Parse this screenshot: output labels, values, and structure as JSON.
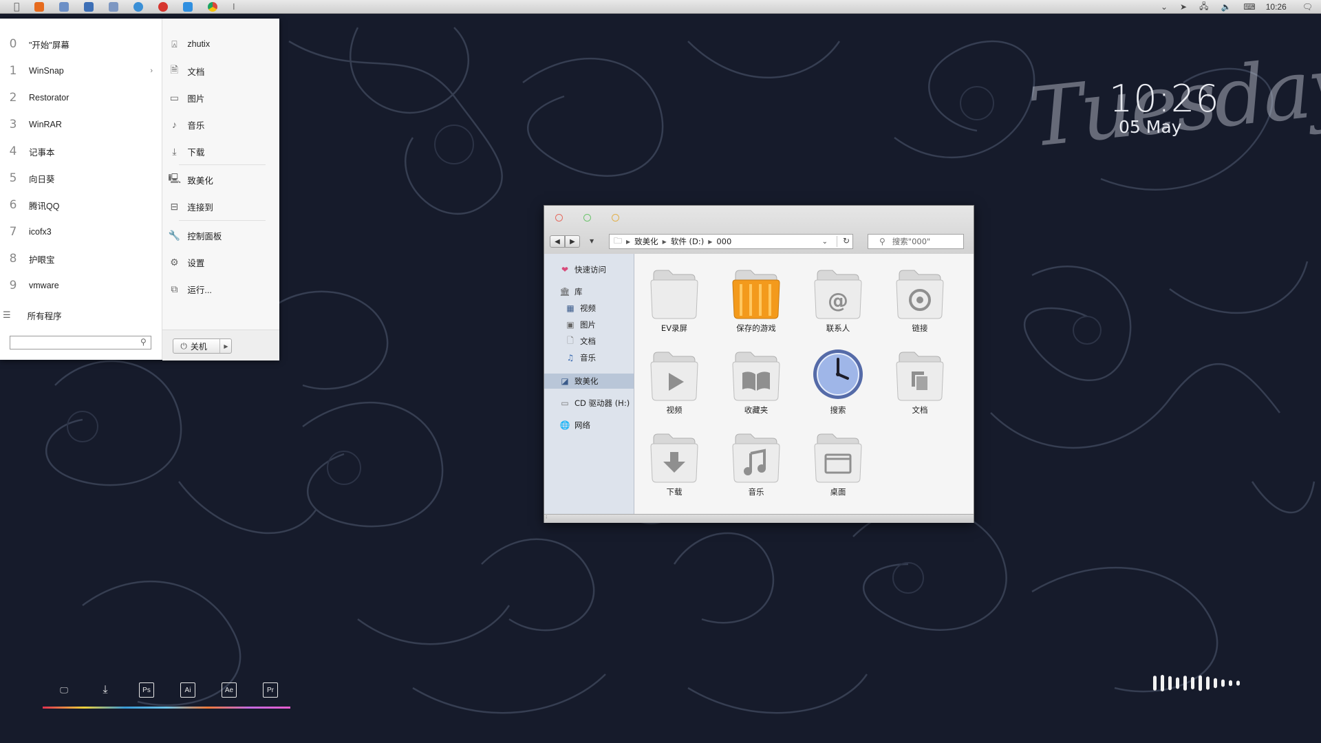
{
  "topbar": {
    "apps": [
      {
        "name": "firefox-icon",
        "color": "#e66b1e"
      },
      {
        "name": "notepad-icon",
        "color": "#6c8fc6"
      },
      {
        "name": "save-icon",
        "color": "#3d6fb6"
      },
      {
        "name": "mail-icon",
        "color": "#7d97c2"
      },
      {
        "name": "telegram-icon",
        "color": "#3a8fd6"
      },
      {
        "name": "netease-music-icon",
        "color": "#d6352e"
      },
      {
        "name": "folder-icon",
        "color": "#2f8fe0"
      },
      {
        "name": "chrome-icon",
        "color": "#e2a32a"
      }
    ],
    "clock": "10:26"
  },
  "start_menu": {
    "left_items": [
      {
        "num": "0",
        "label": "\"开始\"屏幕"
      },
      {
        "num": "1",
        "label": "WinSnap",
        "arrow": "›"
      },
      {
        "num": "2",
        "label": "Restorator"
      },
      {
        "num": "3",
        "label": "WinRAR"
      },
      {
        "num": "4",
        "label": "记事本"
      },
      {
        "num": "5",
        "label": "向日葵"
      },
      {
        "num": "6",
        "label": "腾讯QQ"
      },
      {
        "num": "7",
        "label": "icofx3"
      },
      {
        "num": "8",
        "label": "护眼宝"
      },
      {
        "num": "9",
        "label": "vmware"
      }
    ],
    "all_programs": "所有程序",
    "search_placeholder": "",
    "right_items": [
      {
        "icon": "user-icon",
        "label": "zhutix"
      },
      {
        "icon": "document-icon",
        "label": "文档"
      },
      {
        "icon": "picture-icon",
        "label": "图片"
      },
      {
        "icon": "music-icon",
        "label": "音乐"
      },
      {
        "icon": "download-icon",
        "label": "下载"
      },
      {
        "icon": "computer-icon",
        "label": "致美化"
      },
      {
        "icon": "connect-icon",
        "label": "连接到"
      },
      {
        "icon": "wrench-icon",
        "label": "控制面板"
      },
      {
        "icon": "gear-icon",
        "label": "设置"
      },
      {
        "icon": "run-icon",
        "label": "运行..."
      }
    ],
    "shutdown_label": "关机"
  },
  "clock_widget": {
    "day": "Tuesday",
    "time": "10:26",
    "date": "05 May"
  },
  "explorer": {
    "breadcrumbs": [
      "致美化",
      "软件 (D:)",
      "000"
    ],
    "search_placeholder": "搜索\"000\"",
    "nav": {
      "quick_access": "快速访问",
      "library": "库",
      "library_items": [
        "视频",
        "图片",
        "文档",
        "音乐"
      ],
      "selected": "致美化",
      "cd_drive": "CD 驱动器 (H:)",
      "network": "网络"
    },
    "items": [
      {
        "icon": "folder-blank-icon",
        "label": "EV录屏"
      },
      {
        "icon": "folder-games-icon",
        "label": "保存的游戏"
      },
      {
        "icon": "folder-contacts-icon",
        "label": "联系人"
      },
      {
        "icon": "folder-links-icon",
        "label": "链接"
      },
      {
        "icon": "folder-video-icon",
        "label": "视频"
      },
      {
        "icon": "folder-favorites-icon",
        "label": "收藏夹"
      },
      {
        "icon": "search-clock-icon",
        "label": "搜索"
      },
      {
        "icon": "folder-documents-icon",
        "label": "文档"
      },
      {
        "icon": "folder-downloads-icon",
        "label": "下载"
      },
      {
        "icon": "folder-music-icon",
        "label": "音乐"
      },
      {
        "icon": "folder-desktop-icon",
        "label": "桌面"
      }
    ],
    "traffic_lights": [
      "#e56a5e",
      "#6cc46c",
      "#e2b04a"
    ]
  },
  "dock": {
    "items": [
      {
        "name": "monitor-icon",
        "label": "",
        "boxed": false
      },
      {
        "name": "download-icon",
        "label": "",
        "boxed": false
      },
      {
        "name": "photoshop-icon",
        "label": "Ps",
        "boxed": true
      },
      {
        "name": "illustrator-icon",
        "label": "Ai",
        "boxed": true
      },
      {
        "name": "after-effects-icon",
        "label": "Ae",
        "boxed": true
      },
      {
        "name": "premiere-icon",
        "label": "Pr",
        "boxed": true
      }
    ],
    "line_colors": [
      "#e0314f",
      "#f0d23a",
      "#3a9bd6",
      "#6ec4e8",
      "#f07a3a",
      "#c46be0",
      "#e85cd0"
    ]
  },
  "audio_widget": {
    "levels": [
      0.9,
      1.0,
      0.85,
      0.7,
      0.9,
      0.75,
      0.95,
      0.8,
      0.6,
      0.45,
      0.35,
      0.3
    ]
  }
}
